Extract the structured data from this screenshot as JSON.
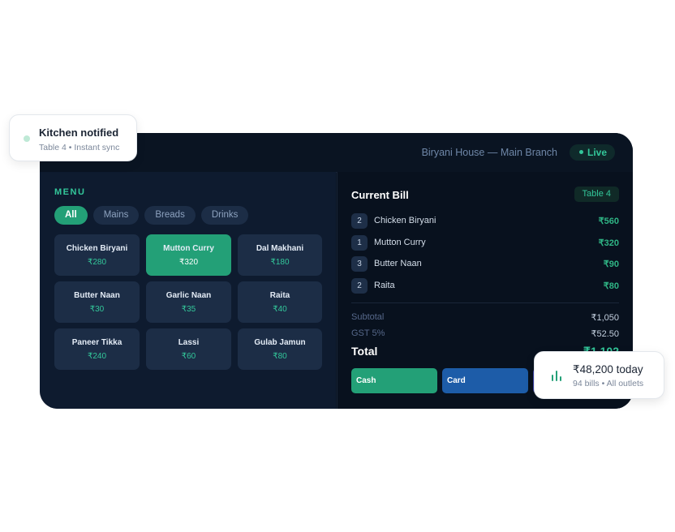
{
  "header": {
    "brand": "Biryani House — Main Branch",
    "live_label": "Live"
  },
  "menu": {
    "title": "MENU",
    "categories": [
      "All",
      "Mains",
      "Breads",
      "Drinks"
    ],
    "active_category": "All",
    "items": [
      {
        "name": "Chicken Biryani",
        "price": "₹280"
      },
      {
        "name": "Mutton Curry",
        "price": "₹320"
      },
      {
        "name": "Dal Makhani",
        "price": "₹180"
      },
      {
        "name": "Butter Naan",
        "price": "₹30"
      },
      {
        "name": "Garlic Naan",
        "price": "₹35"
      },
      {
        "name": "Raita",
        "price": "₹40"
      },
      {
        "name": "Paneer Tikka",
        "price": "₹240"
      },
      {
        "name": "Lassi",
        "price": "₹60"
      },
      {
        "name": "Gulab Jamun",
        "price": "₹80"
      }
    ],
    "selected_item": "Mutton Curry"
  },
  "bill": {
    "title": "Current Bill",
    "table": "Table 4",
    "lines": [
      {
        "qty": "2",
        "name": "Chicken Biryani",
        "amount": "₹560"
      },
      {
        "qty": "1",
        "name": "Mutton Curry",
        "amount": "₹320"
      },
      {
        "qty": "3",
        "name": "Butter Naan",
        "amount": "₹90"
      },
      {
        "qty": "2",
        "name": "Raita",
        "amount": "₹80"
      }
    ],
    "subtotal_label": "Subtotal",
    "subtotal": "₹1,050",
    "gst_label": "GST 5%",
    "gst": "₹52.50",
    "total_label": "Total",
    "total": "₹1,102",
    "pay_buttons": {
      "cash": "Cash",
      "card": "Card"
    }
  },
  "notifications": {
    "kitchen": {
      "title": "Kitchen notified",
      "subtitle": "Table 4 • Instant sync"
    },
    "sales": {
      "title": "₹48,200 today",
      "subtitle": "94 bills • All outlets"
    }
  },
  "colors": {
    "accent": "#23a077",
    "card_blue": "#1d5ca8",
    "panel_dark": "#0b1524"
  }
}
